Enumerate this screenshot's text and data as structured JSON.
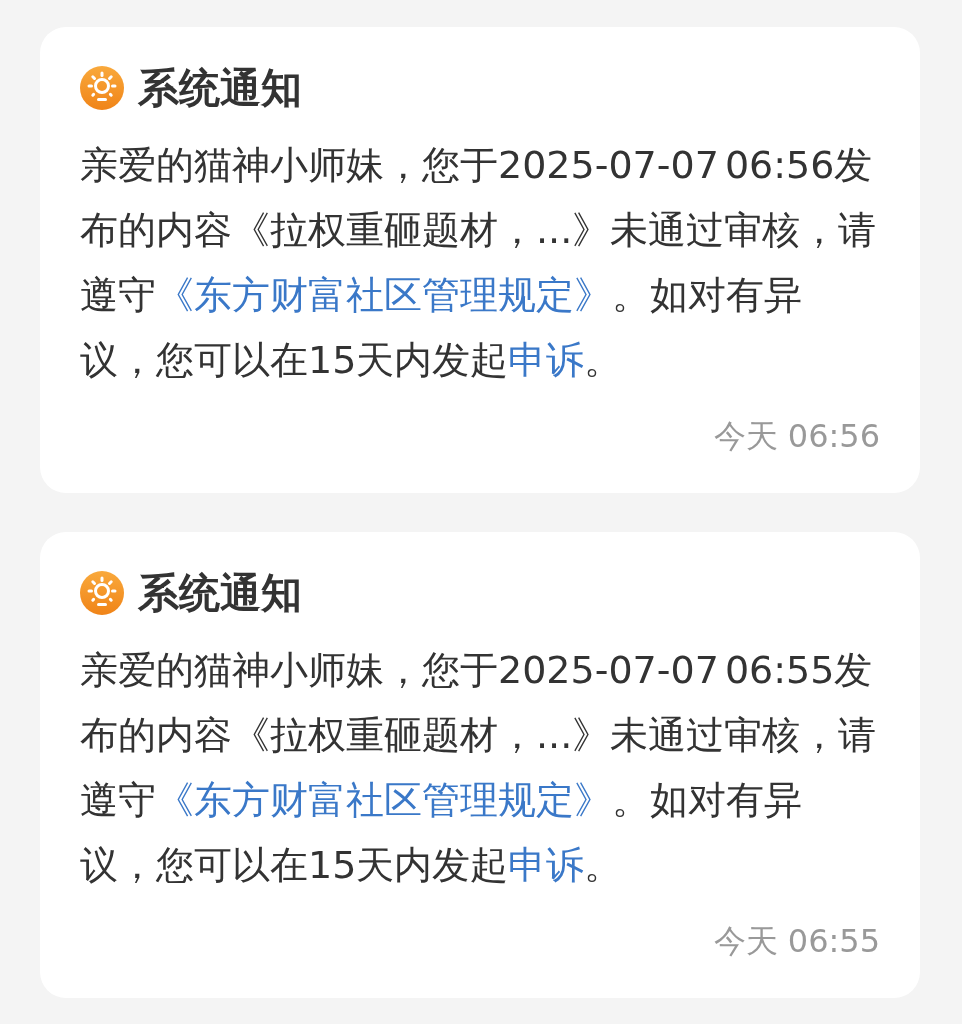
{
  "notifications": [
    {
      "title": "系统通知",
      "message": [
        {
          "kind": "text",
          "text": "亲爱的猫神小师妹，您于2025-07-07 06:56发布的内容《拉权重砸题材，...》未通过审核，请遵守"
        },
        {
          "kind": "link",
          "text": "《东方财富社区管理规定》"
        },
        {
          "kind": "text",
          "text": "。如对有异议，您可以在15天内发起"
        },
        {
          "kind": "link",
          "text": "申诉"
        },
        {
          "kind": "text",
          "text": "。"
        }
      ],
      "time": "今天 06:56"
    },
    {
      "title": "系统通知",
      "message": [
        {
          "kind": "text",
          "text": "亲爱的猫神小师妹，您于2025-07-07 06:55发布的内容《拉权重砸题材，...》未通过审核，请遵守"
        },
        {
          "kind": "link",
          "text": "《东方财富社区管理规定》"
        },
        {
          "kind": "text",
          "text": "。如对有异议，您可以在15天内发起"
        },
        {
          "kind": "link",
          "text": "申诉"
        },
        {
          "kind": "text",
          "text": "。"
        }
      ],
      "time": "今天 06:55"
    }
  ]
}
